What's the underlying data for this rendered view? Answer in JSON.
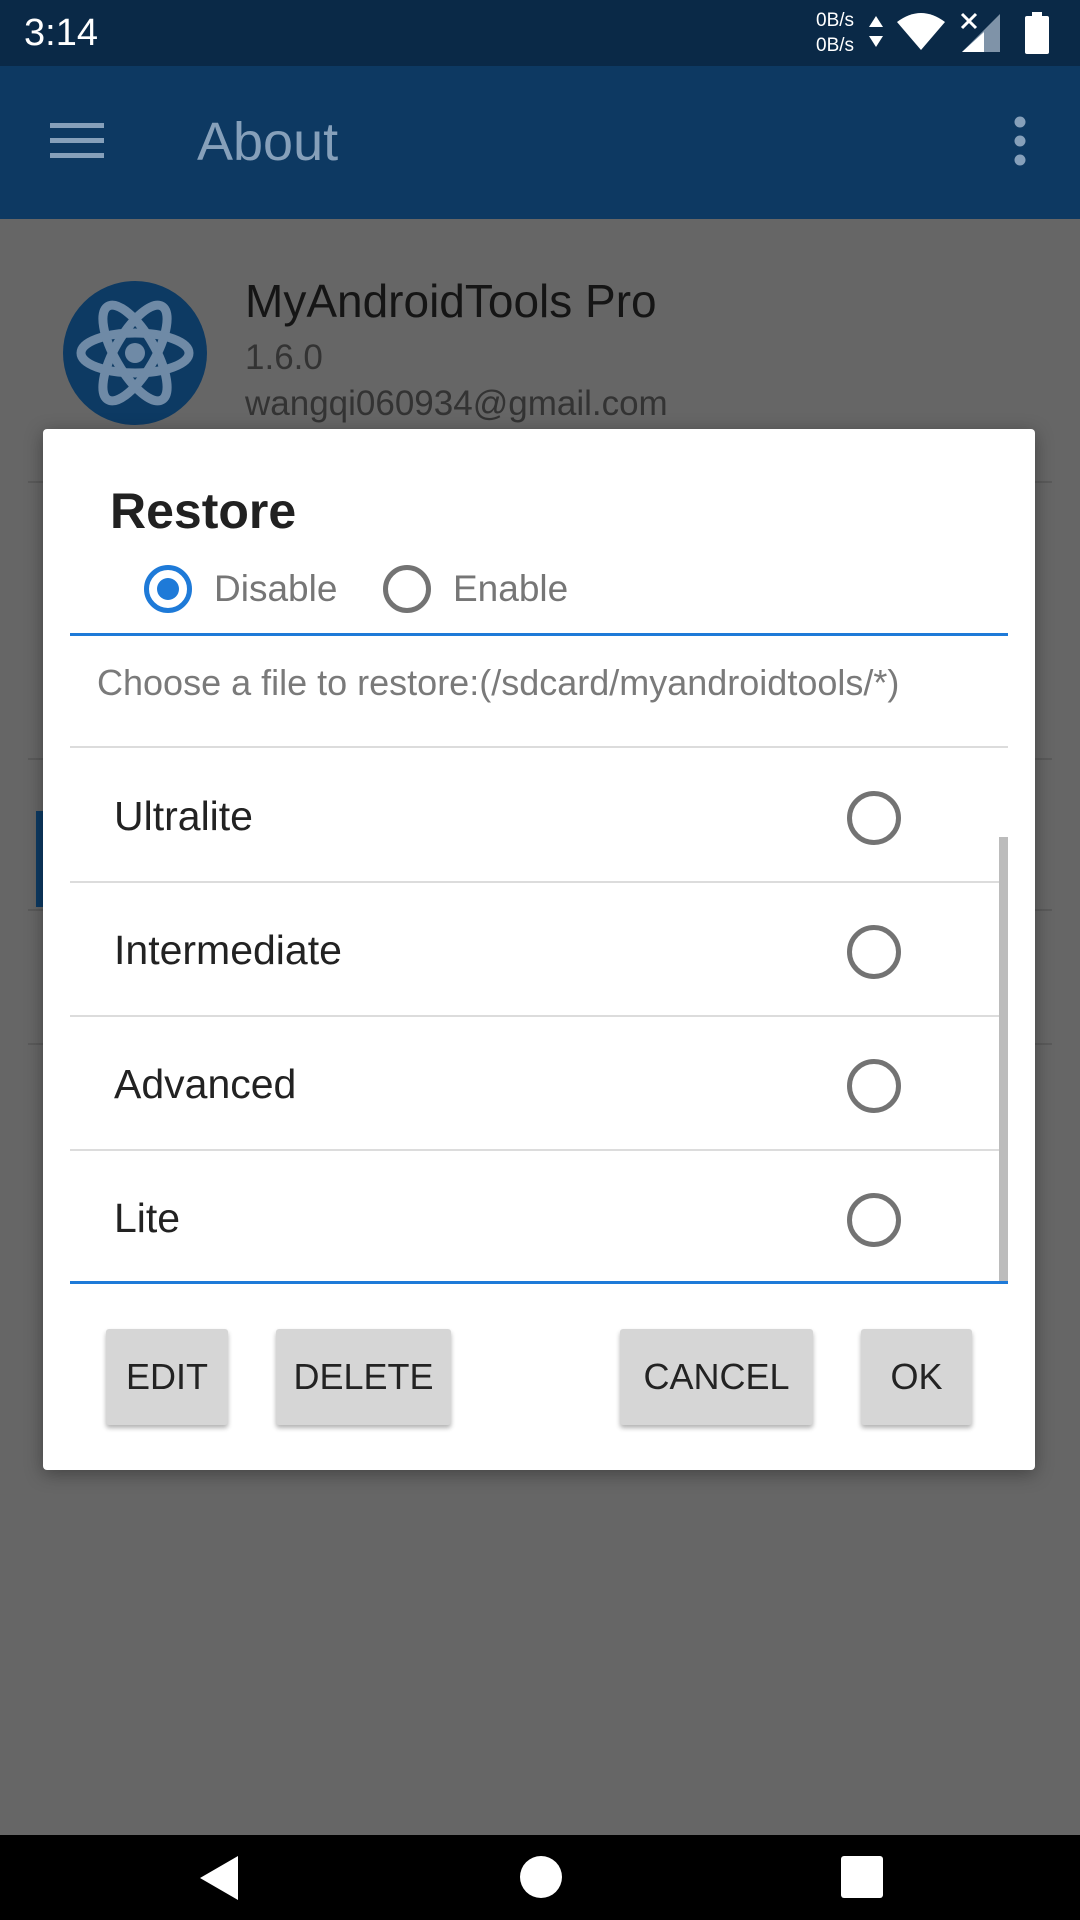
{
  "status_bar": {
    "time": "3:14",
    "net_up": "0B/s",
    "net_down": "0B/s",
    "icons": [
      "net-arrows-icon",
      "wifi-icon",
      "signal-icon",
      "battery-icon"
    ]
  },
  "app_bar": {
    "title": "About",
    "icons": [
      "menu-icon",
      "overflow-menu-icon"
    ]
  },
  "app_info": {
    "name": "MyAndroidTools Pro",
    "version": "1.6.0",
    "email": "wangqi060934@gmail.com",
    "logo_icon": "atom-logo-icon"
  },
  "dialog": {
    "title": "Restore",
    "mode_options": [
      {
        "label": "Disable",
        "checked": true
      },
      {
        "label": "Enable",
        "checked": false
      }
    ],
    "hint": "Choose a file to restore:(/sdcard/myandroidtools/*)",
    "files": [
      {
        "label": "Ultralite",
        "checked": false
      },
      {
        "label": "Intermediate",
        "checked": false
      },
      {
        "label": "Advanced",
        "checked": false
      },
      {
        "label": "Lite",
        "checked": false
      }
    ],
    "buttons": {
      "edit": "EDIT",
      "delete": "DELETE",
      "cancel": "CANCEL",
      "ok": "OK"
    }
  },
  "nav_bar": {
    "icons": [
      "back-icon",
      "home-icon",
      "recents-icon"
    ]
  },
  "colors": {
    "accent": "#1e7ad8",
    "status_bar": "#0a2947",
    "app_bar_dimmed": "#0d3962",
    "scrim_background": "#666666"
  }
}
